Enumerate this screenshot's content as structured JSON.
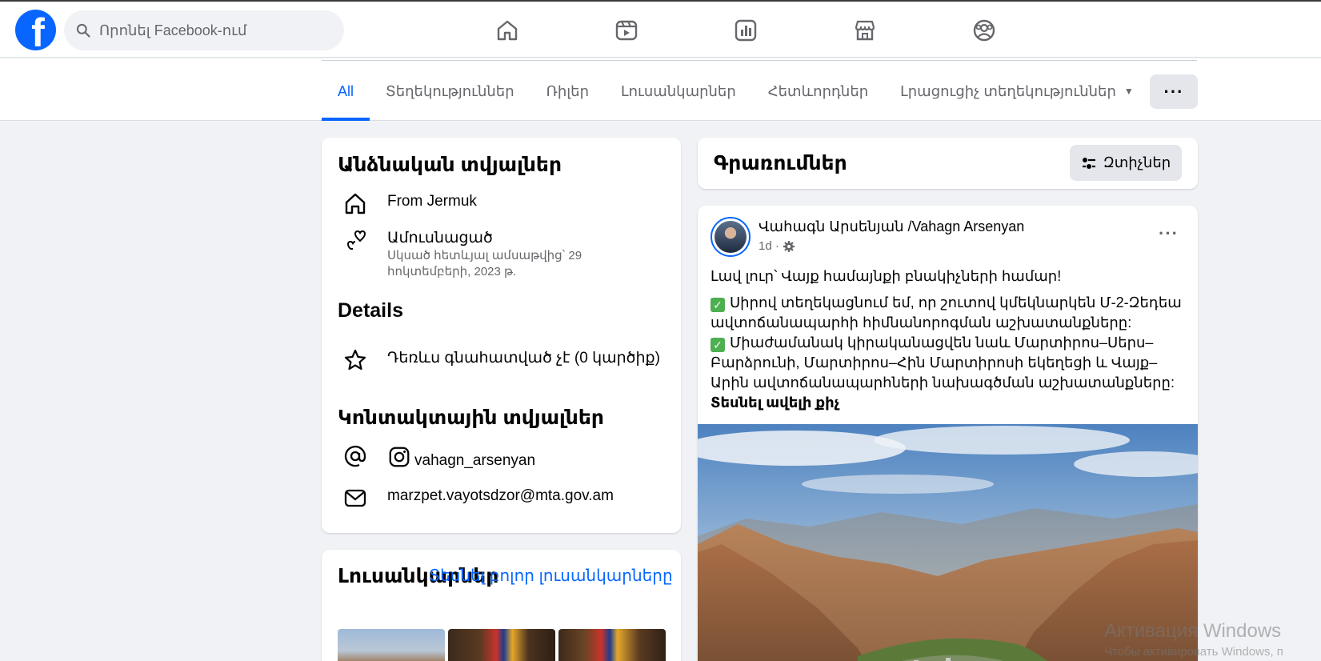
{
  "topbar": {
    "logo": "f",
    "search_placeholder": "Որոնել Facebook-ում",
    "nav_icons": [
      "home-icon",
      "video-icon",
      "dashboard-icon",
      "marketplace-icon",
      "groups-icon"
    ]
  },
  "tabs": {
    "items": [
      {
        "label": "All",
        "active": true
      },
      {
        "label": "Տեղեկություններ",
        "active": false
      },
      {
        "label": "Ռիլեր",
        "active": false
      },
      {
        "label": "Լուսանկարներ",
        "active": false
      },
      {
        "label": "Հետևորդներ",
        "active": false
      },
      {
        "label": "Լրացուցիչ տեղեկություններ",
        "active": false
      }
    ],
    "caret": "▼",
    "more_label": "···"
  },
  "about": {
    "title": "Անձնական տվյալներ",
    "hometown": "From Jermuk",
    "relationship": "Ամուսնացած",
    "relationship_since": "Սկսած հետևյալ ամսաթվից՝ 29 հոկտեմբերի, 2023 թ.",
    "details_title": "Details",
    "rating": "Դեռևս գնահատված չէ (0 կարծիք)",
    "contact_title": "Կոնտակտային տվյալներ",
    "instagram": "vahagn_arsenyan",
    "email": "marzpet.vayotsdzor@mta.gov.am"
  },
  "photos": {
    "title": "Լուսանկարներ",
    "see_all": "Տեսնել բոլոր լուսանկարները"
  },
  "posts": {
    "title": "Գրառումներ",
    "filter_label": "Զտիչներ"
  },
  "post": {
    "author": "Վահագն Արսենյան /Vahagn Arsenyan",
    "time": "1d",
    "meta_sep": "·",
    "more_label": "···",
    "line1": "Լավ լուր՝ Վայք համայնքի բնակիչների համար!",
    "para1": "Սիրով տեղեկացնում եմ, որ շուտով կմեկնարկեն Մ-2-Զեդեա ավտոճանապարհի հիմնանորոգման աշխատանքները:",
    "para2": "Միաժամանակ կիրականացվեն նաև Մարտիրոս–Սերս–Բարձրունի, Մարտիրոս–Հին Մարտիրոսի եկեղեցի և Վայք–Արին ավտոճանապարհների նախագծման աշխատանքները:",
    "see_more": "Տեսնել ավելի քիչ"
  },
  "watermark": {
    "line1": "Активация Windows",
    "line2": "Чтобы активировать Windows, п"
  }
}
